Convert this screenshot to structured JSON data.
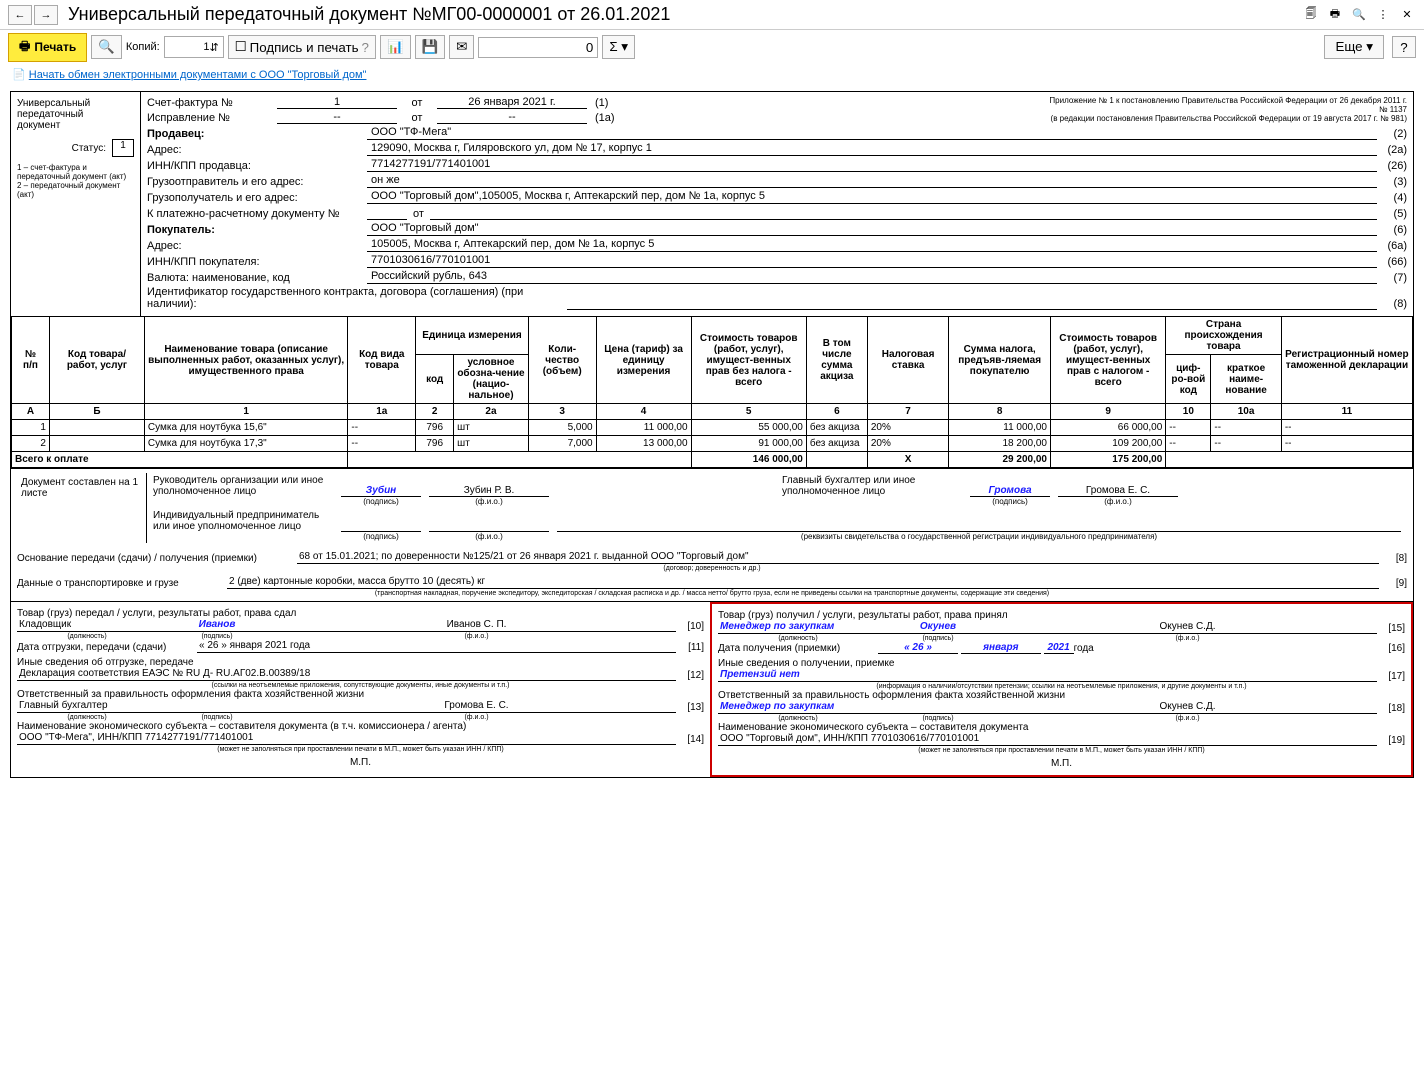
{
  "title": "Универсальный передаточный документ №МГ00-0000001 от 26.01.2021",
  "toolbar": {
    "print": "Печать",
    "copies": "Копий:",
    "copies_val": "1",
    "sign_print": "Подпись и печать",
    "zero": "0",
    "more": "Еще"
  },
  "link": "Начать обмен электронными документами с ООО \"Торговый дом\"",
  "status_box": {
    "line1": "Универсальный",
    "line2": "передаточный",
    "line3": "документ",
    "status_label": "Статус:",
    "status_val": "1",
    "note": "1 – счет-фактура и передаточный документ (акт)\n2 – передаточный документ (акт)"
  },
  "header": {
    "appendix1": "Приложение № 1 к постановлению Правительства Российской Федерации от 26 декабря 2011 г. № 1137",
    "appendix2": "(в редакции постановления Правительства Российской Федерации от 19 августа 2017 г. № 981)",
    "invoice_label": "Счет-фактура №",
    "invoice_num": "1",
    "from": "от",
    "invoice_date": "26 января 2021 г.",
    "suffix1": "(1)",
    "correction_label": "Исправление №",
    "correction_num": "--",
    "correction_date": "--",
    "suffix1a": "(1а)",
    "seller": "Продавец:",
    "seller_val": "ООО \"ТФ-Мега\"",
    "addr": "Адрес:",
    "seller_addr": "129090, Москва г, Гиляровского ул, дом № 17, корпус 1",
    "inn_seller": "ИНН/КПП продавца:",
    "inn_seller_val": "7714277191/771401001",
    "shipper": "Грузоотправитель и его адрес:",
    "shipper_val": "он же",
    "consignee": "Грузополучатель и его адрес:",
    "consignee_val": "ООО \"Торговый дом\",105005, Москва г, Аптекарский пер, дом № 1а, корпус 5",
    "payment": "К платежно-расчетному документу №",
    "payment_from": "от",
    "buyer": "Покупатель:",
    "buyer_val": "ООО \"Торговый дом\"",
    "buyer_addr": "105005, Москва г, Аптекарский пер, дом № 1а, корпус 5",
    "inn_buyer": "ИНН/КПП покупателя:",
    "inn_buyer_val": "7701030616/770101001",
    "currency": "Валюта: наименование, код",
    "currency_val": "Российский рубль, 643",
    "contract_id": "Идентификатор государственного контракта, договора (соглашения) (при наличии):",
    "codes": {
      "c2": "(2)",
      "c2a": "(2а)",
      "c26": "(26)",
      "c3": "(3)",
      "c4": "(4)",
      "c5": "(5)",
      "c6": "(6)",
      "c6a": "(6а)",
      "c66": "(66)",
      "c7": "(7)",
      "c8": "(8)"
    }
  },
  "table": {
    "headers": {
      "no": "№\nп/п",
      "code": "Код товара/\nработ, услуг",
      "name": "Наименование товара (описание выполненных работ, оказанных услуг), имущественного права",
      "kind": "Код вида товара",
      "unit": "Единица измерения",
      "unit_code": "код",
      "unit_name": "условное обозна-чение (нацио-нальное)",
      "qty": "Коли-чество (объем)",
      "price": "Цена (тариф) за единицу измерения",
      "cost_no_tax": "Стоимость товаров (работ, услуг), имущест-венных прав без налога - всего",
      "excise": "В том числе сумма акциза",
      "tax_rate": "Налоговая ставка",
      "tax_sum": "Сумма налога, предъяв-ляемая покупателю",
      "cost_tax": "Стоимость товаров (работ, услуг), имущест-венных прав с налогом - всего",
      "country": "Страна происхождения товара",
      "country_code": "циф-ро-вой код",
      "country_name": "краткое наиме-нование",
      "customs": "Регистрационный номер таможенной декларации"
    },
    "rownums": {
      "A": "А",
      "B": "Б",
      "c1": "1",
      "c1a": "1а",
      "c2": "2",
      "c2a": "2а",
      "c3": "3",
      "c4": "4",
      "c5": "5",
      "c6": "6",
      "c7": "7",
      "c8": "8",
      "c9": "9",
      "c10": "10",
      "c10a": "10а",
      "c11": "11"
    },
    "rows": [
      {
        "no": "1",
        "code": "",
        "name": "Сумка для ноутбука 15,6\"",
        "kind": "--",
        "ucode": "796",
        "uname": "шт",
        "qty": "5,000",
        "price": "11 000,00",
        "cost": "55 000,00",
        "excise": "без акциза",
        "rate": "20%",
        "tax": "11 000,00",
        "total": "66 000,00",
        "ccode": "--",
        "cname": "--",
        "customs": "--"
      },
      {
        "no": "2",
        "code": "",
        "name": "Сумка для ноутбука 17,3\"",
        "kind": "--",
        "ucode": "796",
        "uname": "шт",
        "qty": "7,000",
        "price": "13 000,00",
        "cost": "91 000,00",
        "excise": "без акциза",
        "rate": "20%",
        "tax": "18 200,00",
        "total": "109 200,00",
        "ccode": "--",
        "cname": "--",
        "customs": "--"
      }
    ],
    "total_label": "Всего к оплате",
    "total_cost": "146 000,00",
    "total_x": "X",
    "total_tax": "29 200,00",
    "total_sum": "175 200,00"
  },
  "sigs": {
    "doc_pages": "Документ составлен на 1 листе",
    "head": "Руководитель организации или иное уполномоченное лицо",
    "head_sig": "Зубин",
    "head_name": "Зубин Р. В.",
    "acct": "Главный бухгалтер или иное уполномоченное лицо",
    "acct_sig": "Громова",
    "acct_name": "Громова Е. С.",
    "ip": "Индивидуальный предприниматель или иное уполномоченное лицо",
    "sub_sig": "(подпись)",
    "sub_name": "(ф.и.о.)",
    "sub_req": "(реквизиты свидетельства о государственной регистрации индивидуального предпринимателя)"
  },
  "basis": {
    "label": "Основание передачи (сдачи) / получения (приемки)",
    "val": "68 от 15.01.2021; по доверенности №125/21 от 26 января 2021 г. выданной ООО \"Торговый дом\"",
    "code": "[8]",
    "sub": "(договор; доверенность и др.)"
  },
  "transport": {
    "label": "Данные о транспортировке и грузе",
    "val": "2 (две) картонные коробки, масса брутто 10 (десять) кг",
    "code": "[9]",
    "sub": "(транспортная накладная, поручение экспедитору, экспедиторская / складская расписка и др. / масса нетто/ брутто груза, если не приведены ссылки на транспортные документы, содержащие эти сведения)"
  },
  "left_sig": {
    "handed": "Товар (груз) передал / услуги, результаты работ, права сдал",
    "position": "Кладовщик",
    "sig": "Иванов",
    "name": "Иванов С. П.",
    "c10": "[10]",
    "date_label": "Дата отгрузки, передачи (сдачи)",
    "date": "« 26 »   января   2021  года",
    "c11": "[11]",
    "other": "Иные сведения об отгрузке, передаче",
    "other_val": "Декларация соответствия ЕАЭС № RU Д- RU.АГ02.В.00389/18",
    "c12": "[12]",
    "other_sub": "(ссылки на неотъемлемые приложения, сопутствующие документы, иные документы и т.п.)",
    "resp": "Ответственный за правильность оформления факта хозяйственной жизни",
    "resp_pos": "Главный бухгалтер",
    "resp_name": "Громова Е. С.",
    "c13": "[13]",
    "econ": "Наименование экономического субъекта – составителя документа (в т.ч. комиссионера / агента)",
    "econ_val": "ООО \"ТФ-Мега\", ИНН/КПП 7714277191/771401001",
    "c14": "[14]",
    "econ_sub": "(может не заполняться при проставлении печати в М.П., может быть указан ИНН / КПП)",
    "mp": "М.П.",
    "sub_pos": "(должность)"
  },
  "right_sig": {
    "received": "Товар (груз) получил / услуги, результаты работ, права принял",
    "position": "Менеджер по закупкам",
    "sig": "Окунев",
    "name": "Окунев С.Д.",
    "c15": "[15]",
    "date_label": "Дата получения (приемки)",
    "date_d": "« 26 »",
    "date_m": "января",
    "date_y": "2021",
    "date_year": "года",
    "c16": "[16]",
    "other": "Иные сведения о получении, приемке",
    "other_val": "Претензий нет",
    "c17": "[17]",
    "other_sub": "(информация о наличии/отсутствии претензии; ссылки на неотъемлемые приложения, и другие документы и т.п.)",
    "resp": "Ответственный за правильность оформления факта хозяйственной жизни",
    "resp_pos": "Менеджер по закупкам",
    "resp_name": "Окунев С.Д.",
    "c18": "[18]",
    "econ": "Наименование экономического субъекта – составителя документа",
    "econ_val": "ООО \"Торговый дом\", ИНН/КПП 7701030616/770101001",
    "c19": "[19]",
    "econ_sub": "(может не заполняться при проставлении печати в М.П., может быть указан ИНН / КПП)",
    "mp": "М.П."
  }
}
